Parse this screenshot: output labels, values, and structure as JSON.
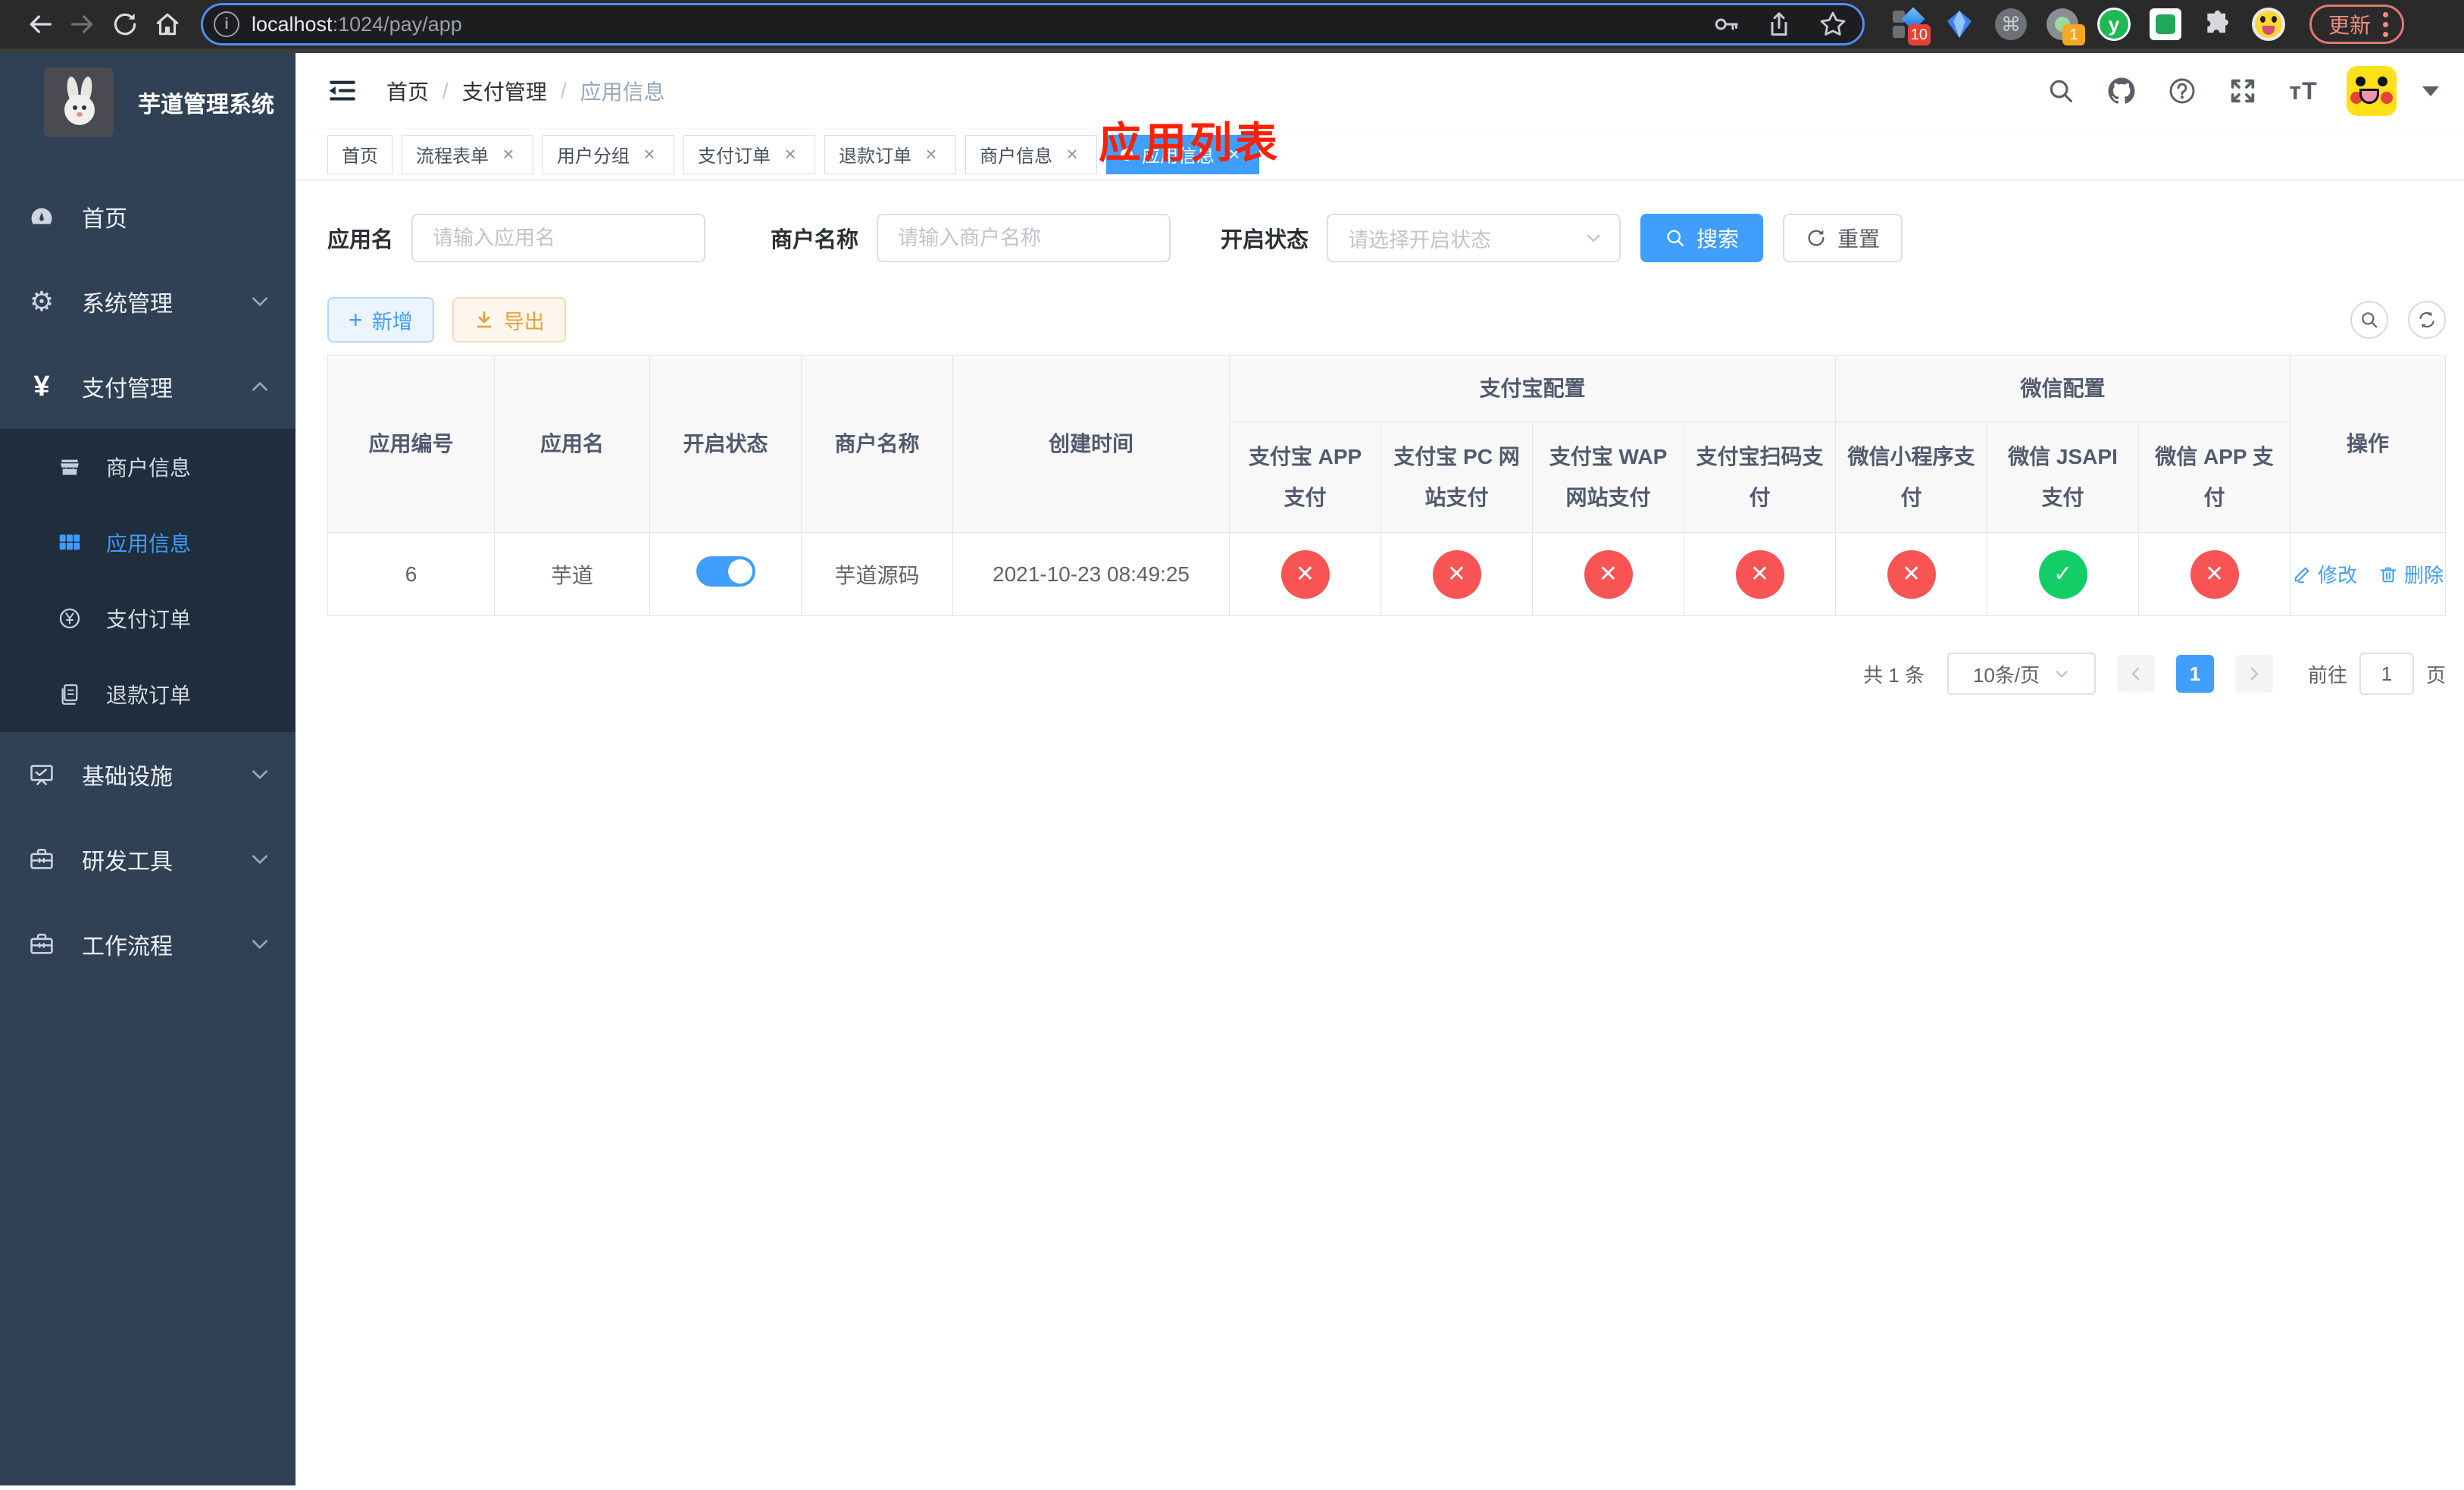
{
  "colors": {
    "accent": "#409EFF",
    "success": "#13CE66",
    "danger": "#F85454",
    "warning": "#E6A23C",
    "annotation_red": "#FF2000",
    "sidebar_bg": "#304156",
    "submenu_bg": "#1F2D3D",
    "chrome_bg": "#2A2A2B",
    "url_focus_ring": "#4E8DF6"
  },
  "icons": {
    "close": "×",
    "check": "✓",
    "cross": "✕",
    "plus": "+",
    "command": "⌘",
    "yen": "¥",
    "gear": "⚙",
    "info": "i",
    "font_size": "тT",
    "ext_y": "y"
  },
  "browser": {
    "url_host": "localhost",
    "url_path": ":1024/pay/app",
    "ext_badge_1": "10",
    "ext_badge_2": "1",
    "update_label": "更新"
  },
  "sidebar": {
    "title": "芋道管理系统",
    "menu": [
      {
        "label": "首页"
      },
      {
        "label": "系统管理"
      },
      {
        "label": "支付管理"
      },
      {
        "label": "基础设施"
      },
      {
        "label": "研发工具"
      },
      {
        "label": "工作流程"
      }
    ],
    "submenu": [
      {
        "label": "商户信息"
      },
      {
        "label": "应用信息"
      },
      {
        "label": "支付订单"
      },
      {
        "label": "退款订单"
      }
    ]
  },
  "breadcrumb": {
    "items": [
      "首页",
      "支付管理",
      "应用信息"
    ],
    "separator": "/"
  },
  "annotation": "应用列表",
  "tabs": [
    {
      "label": "首页"
    },
    {
      "label": "流程表单"
    },
    {
      "label": "用户分组"
    },
    {
      "label": "支付订单"
    },
    {
      "label": "退款订单"
    },
    {
      "label": "商户信息"
    },
    {
      "label": "应用信息"
    }
  ],
  "filters": {
    "app_name_label": "应用名",
    "app_name_placeholder": "请输入应用名",
    "merchant_label": "商户名称",
    "merchant_placeholder": "请输入商户名称",
    "status_label": "开启状态",
    "status_placeholder": "请选择开启状态",
    "search_button": "搜索",
    "reset_button": "重置"
  },
  "toolbar": {
    "add_button": "新增",
    "export_button": "导出"
  },
  "table": {
    "headers": {
      "app_id": "应用编号",
      "app_name": "应用名",
      "status": "开启状态",
      "merchant": "商户名称",
      "created": "创建时间",
      "alipay_group": "支付宝配置",
      "wechat_group": "微信配置",
      "alipay_app": "支付宝 APP 支付",
      "alipay_pc": "支付宝 PC 网站支付",
      "alipay_wap": "支付宝 WAP 网站支付",
      "alipay_qr": "支付宝扫码支付",
      "wx_lite": "微信小程序支付",
      "wx_jsapi": "微信 JSAPI 支付",
      "wx_app": "微信 APP 支付",
      "actions": "操作"
    },
    "row": {
      "app_id": "6",
      "app_name": "芋道",
      "status_on": true,
      "merchant": "芋道源码",
      "created": "2021-10-23 08:49:25",
      "configs": [
        false,
        false,
        false,
        false,
        false,
        true,
        false
      ],
      "edit_label": "修改",
      "delete_label": "删除"
    }
  },
  "pagination": {
    "total": "共 1 条",
    "page_size": "10条/页",
    "page": "1",
    "goto_label": "前往",
    "goto_value": "1",
    "unit_label": "页"
  }
}
